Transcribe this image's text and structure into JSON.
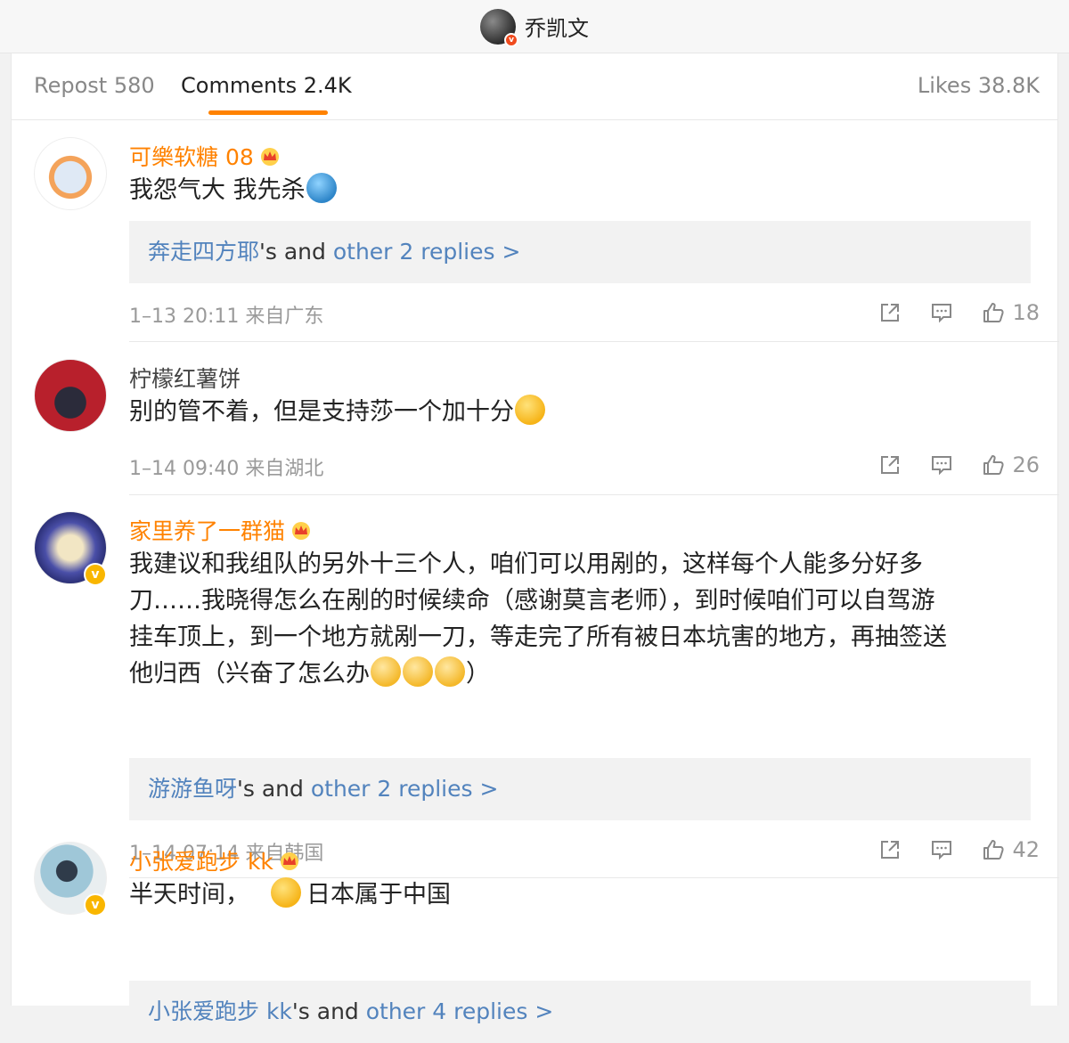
{
  "header": {
    "title": "乔凯文"
  },
  "tabs": {
    "repost": "Repost 580",
    "comments": "Comments 2.4K",
    "likes": "Likes 38.8K"
  },
  "comments": [
    {
      "user": "可樂软糖 08",
      "text": "我怨气大 我先杀",
      "replies": {
        "who": "奔走四方耶",
        "mid": "'s and ",
        "link": "other 2 replies >"
      },
      "time": "1–13 20:11 来自广东",
      "likes": "18"
    },
    {
      "user": "柠檬红薯饼",
      "text": "别的管不着，但是支持莎一个加十分",
      "time": "1–14 09:40 来自湖北",
      "likes": "26"
    },
    {
      "user": "家里养了一群猫",
      "text_lines": [
        "我建议和我组队的另外十三个人，咱们可以用剐的，这样每个人能多分好多",
        "刀……我晓得怎么在剐的时候续命（感谢莫言老师），到时候咱们可以自驾游",
        "挂车顶上，到一个地方就剐一刀，等走完了所有被日本坑害的地方，再抽签送",
        "他归西（兴奋了怎么办",
        "）"
      ],
      "replies": {
        "who": "游游鱼呀",
        "mid": "'s and ",
        "link": "other 2 replies >"
      },
      "time": "1–14 07:14 来自韩国",
      "likes": "42"
    },
    {
      "user": "小张爱跑步 kk",
      "text_a": "半天时间，",
      "text_b": "日本属于中国",
      "replies": {
        "who": "小张爱跑步 kk",
        "mid": "'s and ",
        "link": "other 4 replies >"
      }
    }
  ]
}
